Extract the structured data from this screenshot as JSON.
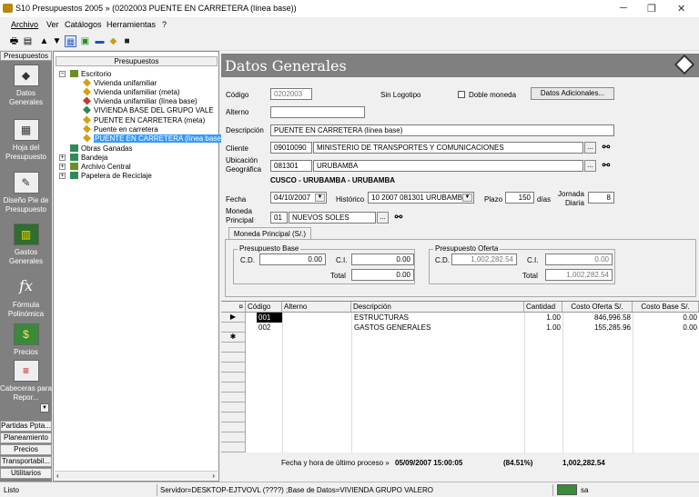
{
  "window": {
    "title": "S10 Presupuestos 2005 » (0202003 PUENTE EN CARRETERA (línea base))"
  },
  "menu": [
    "Archivo",
    "Ver",
    "Catálogos",
    "Herramientas",
    "?"
  ],
  "sidebar": {
    "header": "Presupuestos",
    "items": [
      {
        "label": "Datos Generales",
        "icon": "diamond-icon"
      },
      {
        "label": "Hoja del Presupuesto",
        "icon": "calculator-icon"
      },
      {
        "label": "Diseño Pie de Presupuesto",
        "icon": "notepad-icon"
      },
      {
        "label": "Gastos Generales",
        "icon": "books-icon"
      },
      {
        "label": "Fórmula Polinómica",
        "icon": "fx-icon"
      },
      {
        "label": "Precios",
        "icon": "money-icon"
      },
      {
        "label": "Cabeceras para Repor...",
        "icon": "note-icon"
      }
    ],
    "bottom_tabs": [
      "Partidas Ppta...",
      "Planeamiento",
      "Precios",
      "Transportabil...",
      "Utilitarios"
    ]
  },
  "tree": {
    "header": "Presupuestos",
    "nodes": [
      {
        "label": "Escritorio",
        "level": 0,
        "expanded": true,
        "icon": "desk-icon",
        "color": "#6b8e23"
      },
      {
        "label": "Vivienda unifamiliar",
        "level": 1,
        "icon": "diamond-icon",
        "color": "#d4a017"
      },
      {
        "label": "Vivienda unifamiliar (meta)",
        "level": 1,
        "icon": "diamond-icon",
        "color": "#d4a017"
      },
      {
        "label": "Vivienda unifamiliar (línea base)",
        "level": 1,
        "icon": "diamond-icon",
        "color": "#c0392b"
      },
      {
        "label": "VIVIENDA BASE DEL GRUPO VALE",
        "level": 1,
        "icon": "diamond-icon",
        "color": "#2e8b57"
      },
      {
        "label": "PUENTE EN CARRETERA (meta)",
        "level": 1,
        "icon": "diamond-icon",
        "color": "#d4a017"
      },
      {
        "label": "Puente en carretera",
        "level": 1,
        "icon": "diamond-icon",
        "color": "#d4a017"
      },
      {
        "label": "PUENTE EN CARRETERA (línea base",
        "level": 1,
        "icon": "diamond-icon",
        "color": "#d4a017",
        "selected": true
      },
      {
        "label": "Obras Ganadas",
        "level": 0,
        "icon": "trophy-icon",
        "color": "#2e8b57"
      },
      {
        "label": "Bandeja",
        "level": 0,
        "expandable": true,
        "icon": "tray-icon",
        "color": "#2e8b57"
      },
      {
        "label": "Archivo Central",
        "level": 0,
        "expandable": true,
        "icon": "cabinet-icon",
        "color": "#6b8e23"
      },
      {
        "label": "Papelera de Reciclaje",
        "level": 0,
        "expandable": true,
        "icon": "trash-icon",
        "color": "#2e8b57"
      }
    ]
  },
  "main": {
    "heading": "Datos Generales",
    "codigo_label": "Código",
    "codigo": "0202003",
    "logo_text": "Sin Logotipo",
    "doble_moneda_label": "Doble moneda",
    "datos_adicionales_btn": "Datos Adicionales...",
    "alterno_label": "Alterno",
    "alterno": "",
    "descripcion_label": "Descripción",
    "descripcion": "PUENTE EN CARRETERA (línea base)",
    "cliente_label": "Cliente",
    "cliente_codigo": "09010090",
    "cliente_nombre": "MINISTERIO DE TRANSPORTES Y COMUNICACIONES",
    "ubicacion_label_1": "Ubicación",
    "ubicacion_label_2": "Geográfica",
    "ubicacion_codigo": "081301",
    "ubicacion_nombre": "URUBAMBA",
    "ubicacion_detalle": "CUSCO - URUBAMBA - URUBAMBA",
    "fecha_label": "Fecha",
    "fecha": "04/10/2007",
    "historico_label": "Histórico",
    "historico": "10 2007 081301 URUBAMB.",
    "plazo_label": "Plazo",
    "plazo": "150",
    "dias_label": "días",
    "jornada_label_1": "Jornada",
    "jornada_label_2": "Diaria",
    "jornada": "8",
    "moneda_label_1": "Moneda",
    "moneda_label_2": "Principal",
    "moneda_codigo": "01",
    "moneda_nombre": "NUEVOS SOLES",
    "tab_label": "Moneda Principal (S/.)",
    "base": {
      "title": "Presupuesto Base",
      "cd_label": "C.D.",
      "cd": "0.00",
      "ci_label": "C.I.",
      "ci": "0.00",
      "total_label": "Total",
      "total": "0.00"
    },
    "oferta": {
      "title": "Presupuesto Oferta",
      "cd_label": "C.D.",
      "cd": "1,002,282.54",
      "ci_label": "C.I.",
      "ci": "0.00",
      "total_label": "Total",
      "total": "1,002,282.54"
    }
  },
  "grid": {
    "columns": [
      "¤",
      "Código",
      "Alterno",
      "Descripción",
      "Cantidad",
      "Costo Oferta S/.",
      "Costo Base S/."
    ],
    "rows": [
      {
        "indicator": "▶",
        "codigo": "001",
        "alterno": "",
        "descripcion": "ESTRUCTURAS",
        "cantidad": "1.00",
        "costo_oferta": "846,996.58",
        "costo_base": "0.00"
      },
      {
        "indicator": "",
        "codigo": "002",
        "alterno": "",
        "descripcion": "GASTOS GENERALES",
        "cantidad": "1.00",
        "costo_oferta": "155,285.96",
        "costo_base": "0.00"
      }
    ],
    "new_row_indicator": "✱"
  },
  "footer": {
    "label": "Fecha y hora de último proceso »",
    "datetime": "05/09/2007 15:00:05",
    "percent": "(84.51%)",
    "total": "1,002,282.54"
  },
  "status": {
    "left": "Listo",
    "server": "Servidor=DESKTOP-EJTVOVL (????) ;Base de Datos=VIVIENDA GRUPO VALERO",
    "user": "sa"
  }
}
